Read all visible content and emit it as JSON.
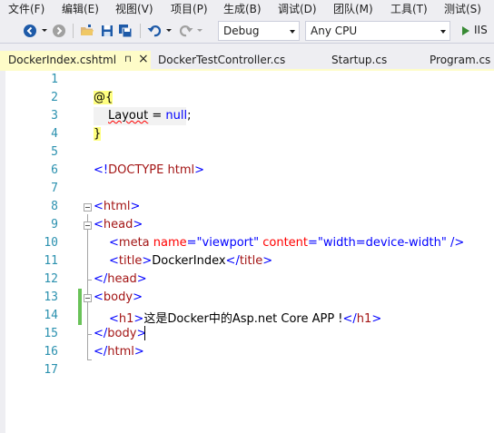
{
  "menu": [
    "文件(F)",
    "编辑(E)",
    "视图(V)",
    "项目(P)",
    "生成(B)",
    "调试(D)",
    "团队(M)",
    "工具(T)",
    "测试(S)"
  ],
  "toolbar": {
    "config_value": "Debug",
    "platform_value": "Any CPU",
    "run_label": "IIS",
    "icons": [
      "back-icon",
      "forward-icon",
      "open-folder-icon",
      "save-icon",
      "save-all-icon",
      "undo-icon",
      "redo-icon"
    ]
  },
  "tabs": [
    {
      "label": "DockerIndex.cshtml",
      "active": true
    },
    {
      "label": "DockerTestController.cs",
      "active": false
    },
    {
      "label": "Startup.cs",
      "active": false
    },
    {
      "label": "Program.cs",
      "active": false
    }
  ],
  "tab_pin_glyph": "⊓",
  "tab_close_glyph": "×",
  "colors": {
    "chrome": "#eeeef2",
    "active_tab": "#fefcc8",
    "line_number": "#2b91af",
    "tag": "#0000ff",
    "element": "#a31515",
    "attribute": "#ff0000",
    "change_marker": "#6ac259"
  },
  "editor": {
    "line_numbers": [
      "1",
      "2",
      "3",
      "4",
      "5",
      "6",
      "7",
      "8",
      "9",
      "10",
      "11",
      "12",
      "13",
      "14",
      "15",
      "16",
      "17"
    ],
    "lines": {
      "l2": {
        "razor_open": "@{"
      },
      "l3": {
        "layout_kw": "Layout",
        "eq": " = ",
        "null_kw": "null",
        "semi": ";"
      },
      "l4": {
        "razor_close": "}"
      },
      "l6": {
        "lt": "<!",
        "doctype": "DOCTYPE",
        "html": " html",
        "gt": ">"
      },
      "l8": {
        "lt": "<",
        "name": "html",
        "gt": ">"
      },
      "l9": {
        "lt": "<",
        "name": "head",
        "gt": ">"
      },
      "l10": {
        "lt": "<",
        "name": "meta",
        "attr1": " name",
        "eq1": "=",
        "val1": "\"viewport\"",
        "attr2": " content",
        "eq2": "=",
        "val2": "\"width=device-width\"",
        "end": " />"
      },
      "l11": {
        "lt": "<",
        "name": "title",
        "gt": ">",
        "text": "DockerIndex",
        "lt2": "</",
        "name2": "title",
        "gt2": ">"
      },
      "l12": {
        "lt": "</",
        "name": "head",
        "gt": ">"
      },
      "l13": {
        "lt": "<",
        "name": "body",
        "gt": ">"
      },
      "l14": {
        "lt": "<",
        "name": "h1",
        "gt": ">",
        "text": "这是Docker中的Asp.net Core APP !",
        "lt2": "</",
        "name2": "h1",
        "gt2": ">"
      },
      "l15": {
        "lt": "</",
        "name": "body",
        "gt": ">"
      },
      "l16": {
        "lt": "</",
        "name": "html",
        "gt": ">"
      }
    }
  }
}
